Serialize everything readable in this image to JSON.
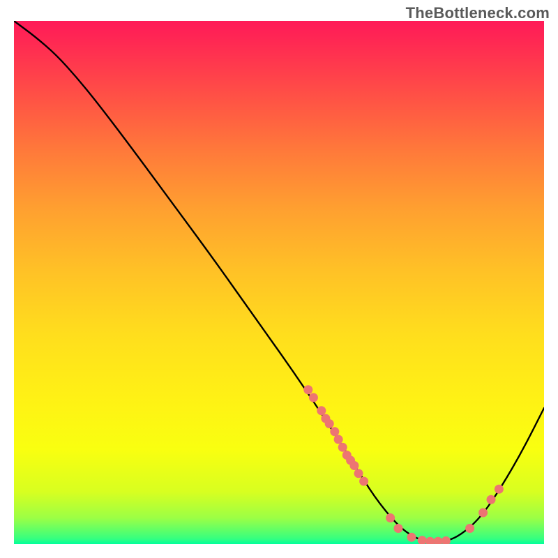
{
  "watermark": "TheBottleneck.com",
  "chart_data": {
    "type": "line",
    "title": "",
    "xlabel": "",
    "ylabel": "",
    "xlim": [
      0,
      100
    ],
    "ylim": [
      0,
      100
    ],
    "curve": [
      {
        "x": 0,
        "y": 100
      },
      {
        "x": 4,
        "y": 97
      },
      {
        "x": 8,
        "y": 93.5
      },
      {
        "x": 12,
        "y": 89
      },
      {
        "x": 16,
        "y": 84
      },
      {
        "x": 22,
        "y": 76
      },
      {
        "x": 30,
        "y": 65
      },
      {
        "x": 38,
        "y": 54
      },
      {
        "x": 46,
        "y": 42.5
      },
      {
        "x": 52,
        "y": 34
      },
      {
        "x": 58,
        "y": 25
      },
      {
        "x": 64,
        "y": 15.5
      },
      {
        "x": 68,
        "y": 9
      },
      {
        "x": 72,
        "y": 4
      },
      {
        "x": 75,
        "y": 1.5
      },
      {
        "x": 78,
        "y": 0.4
      },
      {
        "x": 81,
        "y": 0.4
      },
      {
        "x": 84,
        "y": 1.5
      },
      {
        "x": 88,
        "y": 5
      },
      {
        "x": 92,
        "y": 11
      },
      {
        "x": 96,
        "y": 18
      },
      {
        "x": 100,
        "y": 26
      }
    ],
    "markers": [
      {
        "x": 55.5,
        "y": 29.5
      },
      {
        "x": 56.5,
        "y": 28
      },
      {
        "x": 58,
        "y": 25.5
      },
      {
        "x": 58.8,
        "y": 24
      },
      {
        "x": 59.5,
        "y": 23
      },
      {
        "x": 60.5,
        "y": 21.5
      },
      {
        "x": 61.2,
        "y": 20
      },
      {
        "x": 62,
        "y": 18.5
      },
      {
        "x": 62.8,
        "y": 17
      },
      {
        "x": 63.5,
        "y": 16
      },
      {
        "x": 64.2,
        "y": 15
      },
      {
        "x": 65,
        "y": 13.5
      },
      {
        "x": 66,
        "y": 12
      },
      {
        "x": 71,
        "y": 5
      },
      {
        "x": 72.5,
        "y": 3
      },
      {
        "x": 75,
        "y": 1.3
      },
      {
        "x": 77,
        "y": 0.7
      },
      {
        "x": 78.5,
        "y": 0.5
      },
      {
        "x": 80,
        "y": 0.5
      },
      {
        "x": 81.5,
        "y": 0.6
      },
      {
        "x": 86,
        "y": 3
      },
      {
        "x": 88.5,
        "y": 6
      },
      {
        "x": 90,
        "y": 8.5
      },
      {
        "x": 91.5,
        "y": 10.5
      }
    ],
    "marker_color": "#ed7572",
    "curve_color": "#000000",
    "background_gradient": {
      "top": "#ff1a58",
      "mid": "#ffde1d",
      "bottom": "#00ff9c"
    }
  }
}
